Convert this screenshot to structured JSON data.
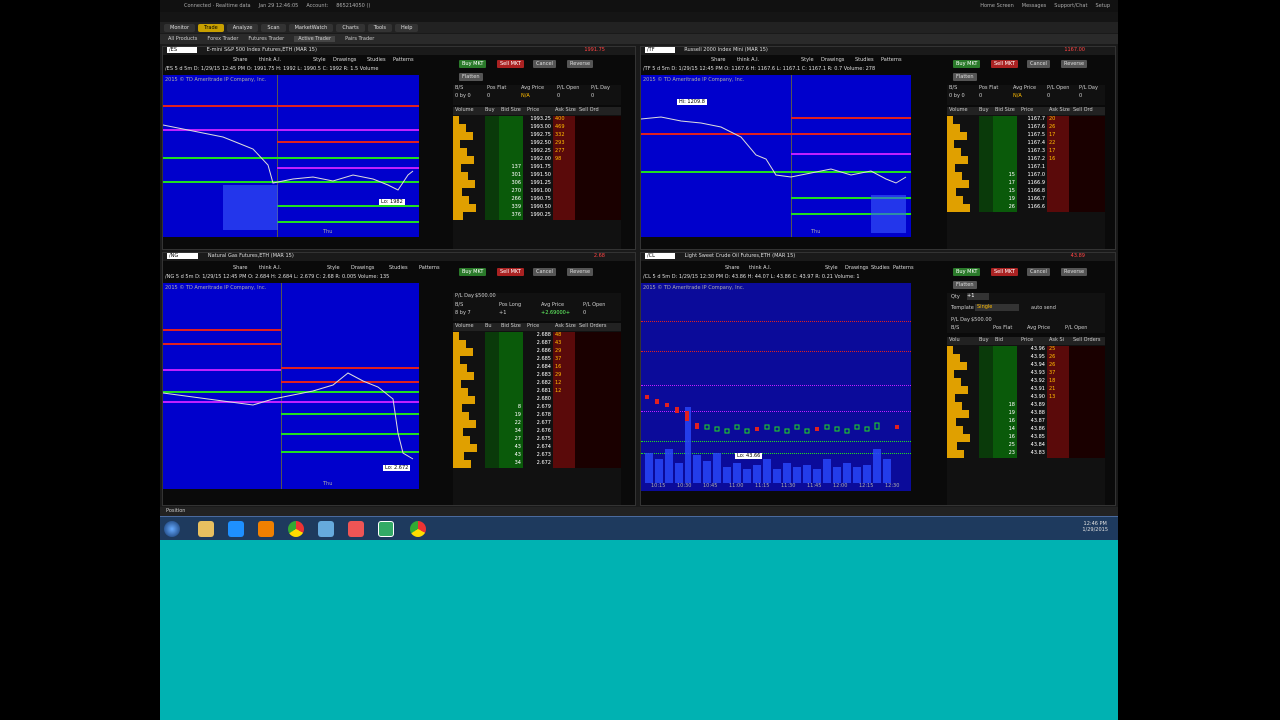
{
  "status": {
    "connected": "Connected · Realtime data",
    "datetime": "Jan 29 12:46:05",
    "account_label": "Account:",
    "account": "865214050 ()",
    "links": [
      "Home Screen",
      "Messages",
      "Support/Chat",
      "Setup"
    ]
  },
  "menu": [
    "Monitor",
    "Trade",
    "Analyze",
    "Scan",
    "MarketWatch",
    "Charts",
    "Tools",
    "Help"
  ],
  "submenu": [
    "All Products",
    "Forex Trader",
    "Futures Trader",
    "Active Trader",
    "Pairs Trader"
  ],
  "panes": [
    {
      "symbol": "/ES",
      "desc": "E-mini S&P 500 Index Futures,ETH (MAR 15)",
      "netpos": "1991.75",
      "buy": "Buy MKT",
      "sell": "Sell MKT",
      "cancel": "Cancel",
      "reverse": "Reverse",
      "flatten": "Flatten",
      "info_labels": [
        "B/S",
        "Pos Flat",
        "Avg Price",
        "P/L Open",
        "P/L Day"
      ],
      "info_vals": [
        "0 by 0",
        "0",
        "N/A",
        "0",
        "0"
      ],
      "ladder": [
        [
          "1993.25",
          "400"
        ],
        [
          "1993.00",
          "469"
        ],
        [
          "1992.75",
          "332"
        ],
        [
          "1992.50",
          "293"
        ],
        [
          "1992.25",
          "277"
        ],
        [
          "1992.00",
          "98"
        ],
        [
          "1991.75",
          ""
        ],
        [
          "1991.50",
          ""
        ],
        [
          "1991.25",
          ""
        ],
        [
          "1991.00",
          ""
        ],
        [
          "1990.75",
          ""
        ],
        [
          "1990.50",
          ""
        ],
        [
          "1990.25",
          ""
        ]
      ],
      "bids": [
        "",
        "",
        "",
        "",
        "",
        "",
        "137",
        "301",
        "306",
        "270",
        "266",
        "339",
        "376"
      ],
      "chart_label": "/ES 5 d 5m",
      "ohlc": "D: 1/29/15 12:45 PM  O: 1991.75  H: 1992  L: 1990.5  C: 1992  R: 1.5  Volume",
      "copyright": "2015 © TD Ameritrade IP Company, Inc.",
      "lo": "Lo: 1982",
      "day": "Thu"
    },
    {
      "symbol": "/TF",
      "desc": "Russell 2000 Index Mini (MAR 15)",
      "netpos": "1167.00",
      "buy": "Buy MKT",
      "sell": "Sell MKT",
      "cancel": "Cancel",
      "reverse": "Reverse",
      "flatten": "Flatten",
      "info_labels": [
        "B/S",
        "Pos Flat",
        "Avg Price",
        "P/L Open",
        "P/L Day"
      ],
      "info_vals": [
        "0 by 0",
        "0",
        "N/A",
        "0",
        "0"
      ],
      "ladder": [
        [
          "1167.7",
          "20"
        ],
        [
          "1167.6",
          "26"
        ],
        [
          "1167.5",
          "17"
        ],
        [
          "1167.4",
          "22"
        ],
        [
          "1167.3",
          "17"
        ],
        [
          "1167.2",
          "16"
        ],
        [
          "1167.1",
          ""
        ],
        [
          "1167.0",
          ""
        ],
        [
          "1166.9",
          ""
        ],
        [
          "1166.8",
          ""
        ],
        [
          "1166.7",
          ""
        ],
        [
          "1166.6",
          ""
        ]
      ],
      "bids": [
        "",
        "",
        "",
        "",
        "",
        "",
        "",
        "15",
        "17",
        "15",
        "19",
        "26"
      ],
      "chart_label": "/TF 5 d 5m",
      "ohlc": "D: 1/29/15 12:45 PM  O: 1167.6  H: 1167.6  L: 1167.1  C: 1167.1  R: 0.7  Volume: 278",
      "copyright": "2015 © TD Ameritrade IP Company, Inc.",
      "hi": "Hi: 1209.8",
      "day": "Thu"
    },
    {
      "symbol": "/NG",
      "desc": "Natural Gas Futures,ETH (MAR 15)",
      "netpos": "2.68",
      "buy": "Buy MKT",
      "sell": "Sell MKT",
      "cancel": "Cancel",
      "reverse": "Reverse",
      "flatten": "Flatten",
      "info_labels": [
        "P/L Day",
        "B/S",
        "Pos Long",
        "Avg Price",
        "P/L Open"
      ],
      "info_vals": [
        "$500.00",
        "8 by 7",
        "+1",
        "+2.69000+",
        "0"
      ],
      "ladder": [
        [
          "2.688",
          "48"
        ],
        [
          "2.687",
          "43"
        ],
        [
          "2.686",
          "29"
        ],
        [
          "2.685",
          "37"
        ],
        [
          "2.684",
          "16"
        ],
        [
          "2.683",
          "29"
        ],
        [
          "2.682",
          "12"
        ],
        [
          "2.681",
          "12"
        ],
        [
          "2.680",
          ""
        ],
        [
          "2.679",
          ""
        ],
        [
          "2.678",
          ""
        ],
        [
          "2.677",
          ""
        ],
        [
          "2.676",
          ""
        ],
        [
          "2.675",
          ""
        ],
        [
          "2.674",
          ""
        ],
        [
          "2.673",
          ""
        ],
        [
          "2.672",
          ""
        ]
      ],
      "bids": [
        "",
        "",
        "",
        "",
        "",
        "",
        "",
        "",
        "",
        "8",
        "19",
        "22",
        "34",
        "27",
        "43",
        "43",
        "34"
      ],
      "chart_label": "/NG 5 d 5m",
      "ohlc": "D: 1/29/15 12:45 PM  O: 2.684  H: 2.684  L: 2.679  C: 2.68  R: 0.005  Volume: 135",
      "copyright": "2015 © TD Ameritrade IP Company, Inc.",
      "lo": "Lo: 2.672",
      "day": "Thu"
    },
    {
      "symbol": "/CL",
      "desc": "Light Sweet Crude Oil Futures,ETH (MAR 15)",
      "netpos": "43.89",
      "buy": "Buy MKT",
      "sell": "Sell MKT",
      "cancel": "Cancel",
      "reverse": "Reverse",
      "flatten": "Flatten",
      "info_labels": [
        "P/L Day",
        "B/S",
        "Pos Flat",
        "Avg Price",
        "P/L Open"
      ],
      "info_vals": [
        "$500.00",
        "0 by 0",
        "0",
        "N/A",
        "0"
      ],
      "ladder": [
        [
          "43.96",
          "25"
        ],
        [
          "43.95",
          "26"
        ],
        [
          "43.94",
          "26"
        ],
        [
          "43.93",
          "37"
        ],
        [
          "43.92",
          "18"
        ],
        [
          "43.91",
          "21"
        ],
        [
          "43.90",
          "13"
        ],
        [
          "43.89",
          ""
        ],
        [
          "43.88",
          ""
        ],
        [
          "43.87",
          ""
        ],
        [
          "43.86",
          ""
        ],
        [
          "43.85",
          ""
        ],
        [
          "43.84",
          ""
        ],
        [
          "43.83",
          ""
        ]
      ],
      "bids": [
        "",
        "",
        "",
        "",
        "",
        "",
        "",
        "18",
        "19",
        "16",
        "14",
        "16",
        "25",
        "23"
      ],
      "chart_label": "/CL 5 d 5m",
      "ohlc": "D: 1/29/15 12:30 PM  O: 43.86  H: 44.07  L: 43.86  C: 43.97  R: 0.21  Volume: 1",
      "copyright": "2015 © TD Ameritrade IP Company, Inc.",
      "lo": "Lo: 43.66",
      "qty": "Qty",
      "template": "Template",
      "single": "Single",
      "autosend": "auto send",
      "times": [
        "10:15",
        "10:30",
        "10:45",
        "11:00",
        "11:15",
        "11:30",
        "11:45",
        "12:00",
        "12:15",
        "12:30"
      ]
    }
  ],
  "position": "Position",
  "taskbar": {
    "time": "12:46 PM",
    "date": "1/29/2015"
  },
  "tools": [
    "Share",
    "think A.I.",
    "Style",
    "Drawings",
    "Studies",
    "Patterns"
  ]
}
